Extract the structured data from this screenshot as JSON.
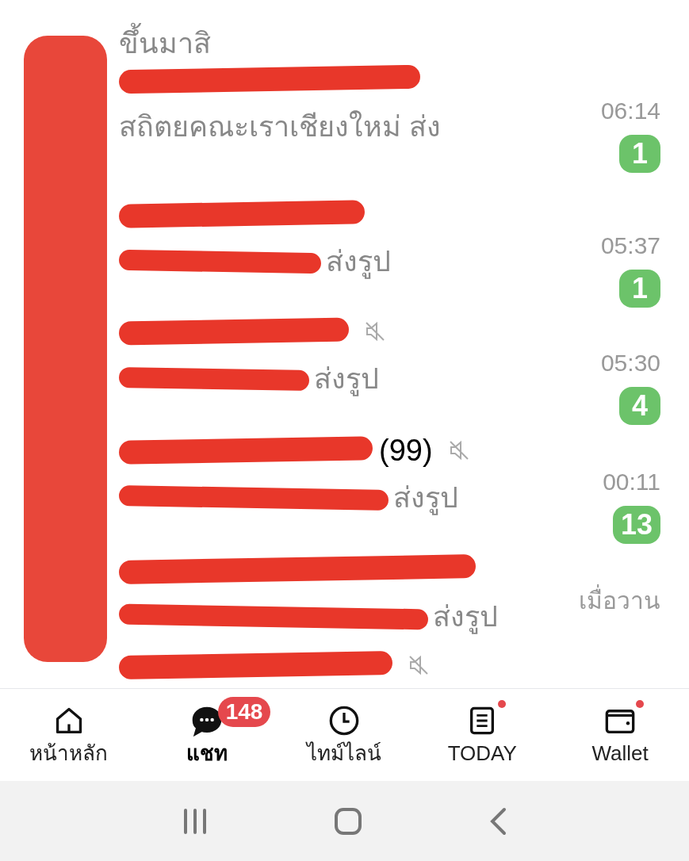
{
  "chat_list": [
    {
      "preview": "ขึ้นมาสิ",
      "muted": false,
      "name_redacted": false,
      "preview_redacted": false
    },
    {
      "preview": "สถิตยคณะเราเชียงใหม่ ส่ง",
      "time": "06:14",
      "unread": "1",
      "muted": false,
      "name_redacted": true,
      "preview_redacted": false
    },
    {
      "preview": "ส่งรูป",
      "time": "05:37",
      "unread": "1",
      "muted": false,
      "name_redacted": true,
      "preview_redacted": true
    },
    {
      "preview": "ส่งรูป",
      "time": "05:30",
      "unread": "4",
      "muted": true,
      "name_redacted": true,
      "preview_redacted": true
    },
    {
      "name_visible": "(99)",
      "preview": "ส่งรูป",
      "time": "00:11",
      "unread": "13",
      "muted": true,
      "name_redacted": true,
      "preview_redacted": true
    },
    {
      "preview": "ส่งรูป",
      "time": "เมื่อวาน",
      "muted": false,
      "name_redacted": true,
      "preview_redacted": true
    },
    {
      "muted": true,
      "name_redacted": true,
      "preview_redacted": false
    }
  ],
  "bottom_nav": [
    {
      "kind": "home",
      "label": "หน้าหลัก",
      "selected": false,
      "dot": false
    },
    {
      "kind": "chat",
      "label": "แชท",
      "selected": true,
      "badge": "148",
      "dot": false
    },
    {
      "kind": "clock",
      "label": "ไทม์ไลน์",
      "selected": false,
      "dot": false
    },
    {
      "kind": "news",
      "label": "TODAY",
      "selected": false,
      "dot": true
    },
    {
      "kind": "wallet",
      "label": "Wallet",
      "selected": false,
      "dot": true
    }
  ]
}
